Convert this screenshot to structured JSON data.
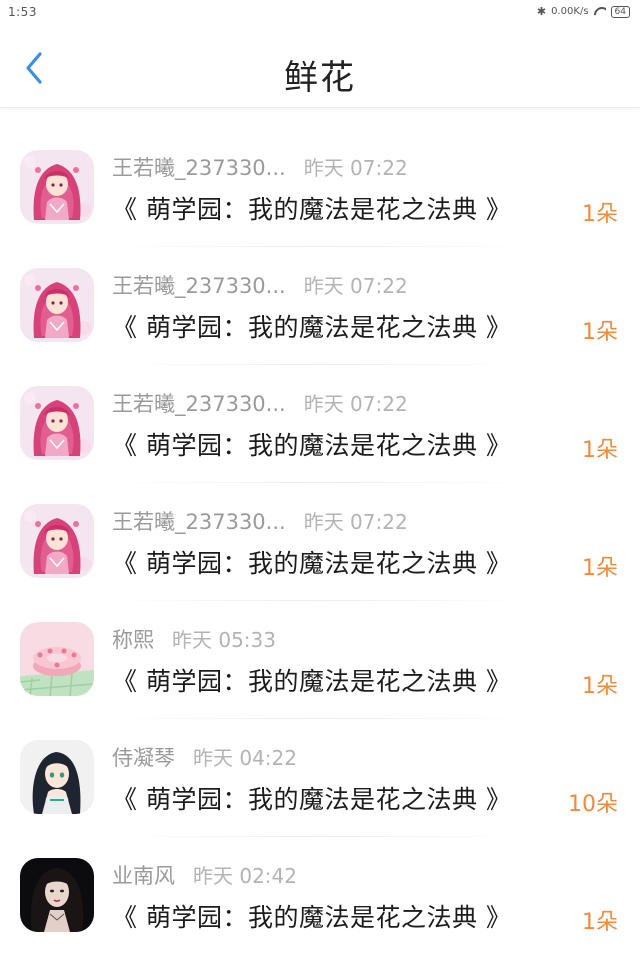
{
  "status_bar": {
    "time": "1:53",
    "network_speed": "0.00K/s",
    "battery": "64",
    "icons": [
      "bluetooth-icon",
      "wifi-icon",
      "battery-icon"
    ]
  },
  "header": {
    "back_icon": "chevron-left-icon",
    "title": "鲜花"
  },
  "colors": {
    "accent_blue": "#3a8ee6",
    "count_orange": "#f08a3c"
  },
  "items": [
    {
      "name": "王若曦_237330...",
      "time": "昨天 07:22",
      "book": "《 萌学园：我的魔法是花之法典 》",
      "count": "1朵",
      "avatar": "anime-girl-pink-avatar"
    },
    {
      "name": "王若曦_237330...",
      "time": "昨天 07:22",
      "book": "《 萌学园：我的魔法是花之法典 》",
      "count": "1朵",
      "avatar": "anime-girl-pink-avatar"
    },
    {
      "name": "王若曦_237330...",
      "time": "昨天 07:22",
      "book": "《 萌学园：我的魔法是花之法典 》",
      "count": "1朵",
      "avatar": "anime-girl-pink-avatar"
    },
    {
      "name": "王若曦_237330...",
      "time": "昨天 07:22",
      "book": "《 萌学园：我的魔法是花之法典 》",
      "count": "1朵",
      "avatar": "anime-girl-pink-avatar"
    },
    {
      "name": "称熙",
      "time": "昨天 05:33",
      "book": "《 萌学园：我的魔法是花之法典 》",
      "count": "1朵",
      "avatar": "cake-avatar"
    },
    {
      "name": "侍凝琴",
      "time": "昨天 04:22",
      "book": "《 萌学园：我的魔法是花之法典 》",
      "count": "10朵",
      "avatar": "anime-girl-dark-hair-avatar"
    },
    {
      "name": "业南风",
      "time": "昨天 02:42",
      "book": "《 萌学园：我的魔法是花之法典 》",
      "count": "1朵",
      "avatar": "girl-portrait-avatar"
    }
  ]
}
